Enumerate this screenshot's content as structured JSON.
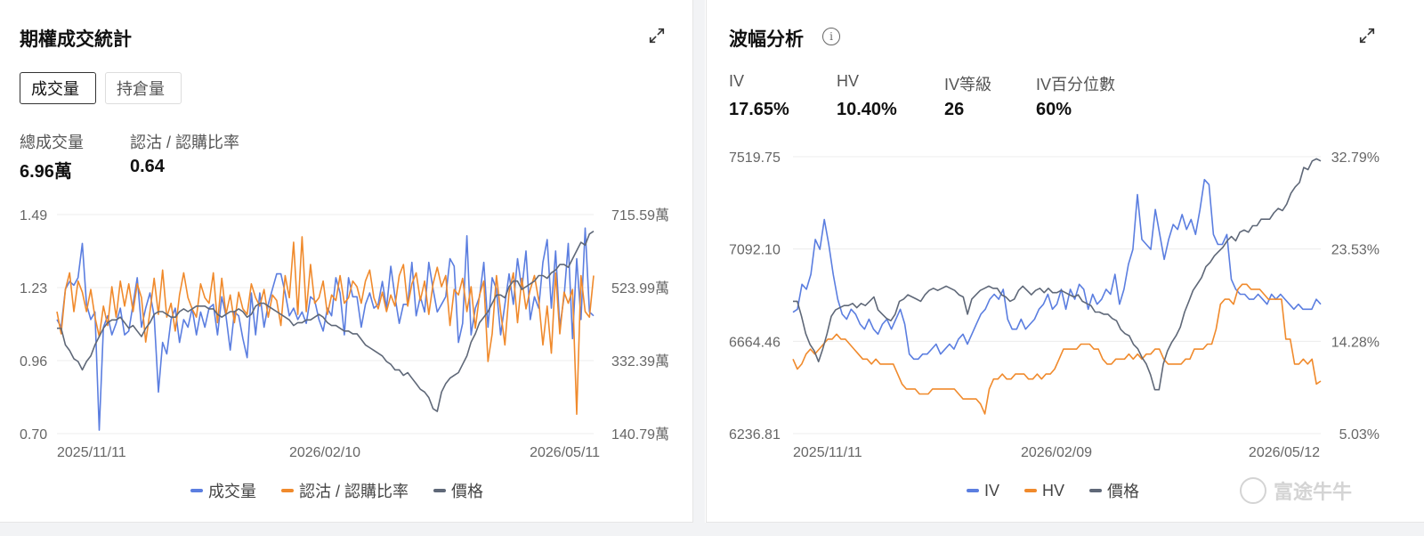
{
  "left": {
    "title": "期權成交統計",
    "tabs": [
      {
        "label": "成交量",
        "active": true
      },
      {
        "label": "持倉量",
        "active": false
      }
    ],
    "stats": [
      {
        "label": "總成交量",
        "value": "6.96萬"
      },
      {
        "label": "認沽 / 認購比率",
        "value": "0.64"
      }
    ]
  },
  "right": {
    "title": "波幅分析",
    "stats": [
      {
        "label": "IV",
        "value": "17.65%"
      },
      {
        "label": "HV",
        "value": "10.40%"
      },
      {
        "label": "IV等級",
        "value": "26"
      },
      {
        "label": "IV百分位數",
        "value": "60%"
      }
    ]
  },
  "watermark": "富途牛牛",
  "colors": {
    "blue": "#5b7ee0",
    "orange": "#f08a2c",
    "gray": "#5f6878"
  },
  "chart_data": [
    {
      "type": "line",
      "y_left_ticks": [
        "1.49",
        "1.23",
        "0.96",
        "0.70"
      ],
      "y_right_ticks": [
        "715.59萬",
        "523.99萬",
        "332.39萬",
        "140.79萬"
      ],
      "x_ticks": [
        "2025/11/11",
        "2026/02/10",
        "2026/05/11"
      ],
      "ylim_left": [
        0.7,
        1.49
      ],
      "ylim_right": [
        140.79,
        715.59
      ],
      "grid": true,
      "legend_position": "bottom",
      "series": [
        {
          "name": "成交量",
          "axis": "right",
          "color": "#5b7ee0",
          "values": [
            440,
            420,
            520,
            540,
            530,
            550,
            640,
            480,
            440,
            460,
            150,
            420,
            450,
            400,
            430,
            470,
            400,
            410,
            480,
            550,
            420,
            470,
            510,
            450,
            250,
            380,
            350,
            440,
            470,
            380,
            440,
            420,
            470,
            400,
            460,
            420,
            470,
            480,
            400,
            500,
            450,
            360,
            460,
            450,
            390,
            340,
            510,
            400,
            510,
            420,
            480,
            520,
            560,
            560,
            510,
            450,
            470,
            440,
            460,
            430,
            500,
            490,
            440,
            410,
            470,
            450,
            550,
            510,
            400,
            550,
            500,
            500,
            420,
            480,
            510,
            470,
            480,
            540,
            470,
            580,
            500,
            430,
            480,
            480,
            590,
            450,
            500,
            460,
            590,
            520,
            460,
            480,
            500,
            600,
            580,
            380,
            430,
            660,
            400,
            470,
            500,
            590,
            420,
            550,
            520,
            400,
            480,
            560,
            480,
            600,
            520,
            620,
            440,
            500,
            470,
            590,
            650,
            470,
            620,
            420,
            500,
            640,
            390,
            600,
            440,
            680,
            460,
            450
          ]
        },
        {
          "name": "認沽 / 認購比率",
          "axis": "left",
          "color": "#f08a2c",
          "values": [
            1.14,
            1.06,
            1.22,
            1.28,
            1.14,
            1.25,
            1.21,
            1.14,
            1.22,
            1.12,
            1.05,
            1.16,
            1.09,
            1.23,
            1.12,
            1.25,
            1.16,
            1.24,
            1.14,
            1.24,
            1.19,
            1.03,
            1.14,
            1.26,
            1.13,
            1.29,
            1.12,
            1.17,
            1.07,
            1.2,
            1.28,
            1.19,
            1.15,
            1.12,
            1.24,
            1.19,
            1.17,
            1.28,
            1.1,
            1.26,
            1.13,
            1.2,
            1.1,
            1.21,
            1.15,
            1.13,
            1.24,
            1.19,
            1.16,
            1.22,
            1.12,
            1.2,
            1.18,
            1.09,
            1.27,
            1.19,
            1.39,
            1.13,
            1.41,
            1.14,
            1.31,
            1.17,
            1.19,
            1.25,
            1.13,
            1.2,
            1.18,
            1.27,
            1.17,
            1.19,
            1.25,
            1.23,
            1.17,
            1.25,
            1.29,
            1.19,
            1.15,
            1.21,
            1.14,
            1.2,
            1.16,
            1.27,
            1.31,
            1.16,
            1.24,
            1.28,
            1.18,
            1.25,
            1.13,
            1.24,
            1.3,
            1.23,
            1.27,
            1.09,
            1.22,
            1.2,
            1.26,
            1.14,
            1.23,
            1.08,
            1.2,
            1.25,
            0.96,
            1.06,
            1.27,
            1.14,
            1.02,
            1.21,
            1.28,
            1.1,
            1.26,
            1.15,
            1.22,
            1.27,
            1.18,
            1.02,
            1.16,
            0.99,
            1.28,
            1.06,
            1.21,
            1.17,
            1.22,
            0.77,
            1.27,
            1.14,
            1.12,
            1.27
          ]
        },
        {
          "name": "價格",
          "axis": "left",
          "color": "#5f6878",
          "values": [
            1.08,
            1.08,
            1.02,
            1.0,
            0.97,
            0.96,
            0.93,
            0.96,
            0.98,
            1.02,
            1.05,
            1.08,
            1.1,
            1.11,
            1.11,
            1.12,
            1.1,
            1.08,
            1.09,
            1.07,
            1.05,
            1.08,
            1.1,
            1.13,
            1.14,
            1.14,
            1.13,
            1.12,
            1.12,
            1.14,
            1.15,
            1.14,
            1.15,
            1.16,
            1.16,
            1.16,
            1.15,
            1.15,
            1.13,
            1.12,
            1.13,
            1.14,
            1.14,
            1.15,
            1.14,
            1.12,
            1.13,
            1.16,
            1.17,
            1.17,
            1.16,
            1.15,
            1.14,
            1.13,
            1.12,
            1.11,
            1.09,
            1.1,
            1.1,
            1.11,
            1.11,
            1.12,
            1.13,
            1.12,
            1.1,
            1.09,
            1.09,
            1.08,
            1.07,
            1.07,
            1.06,
            1.06,
            1.04,
            1.02,
            1.01,
            1.0,
            0.99,
            0.98,
            0.96,
            0.95,
            0.93,
            0.93,
            0.91,
            0.92,
            0.9,
            0.88,
            0.86,
            0.85,
            0.83,
            0.79,
            0.78,
            0.85,
            0.88,
            0.9,
            0.91,
            0.92,
            0.95,
            0.98,
            1.03,
            1.06,
            1.1,
            1.12,
            1.14,
            1.17,
            1.2,
            1.2,
            1.19,
            1.23,
            1.25,
            1.25,
            1.22,
            1.23,
            1.24,
            1.25,
            1.27,
            1.27,
            1.26,
            1.28,
            1.29,
            1.31,
            1.31,
            1.3,
            1.33,
            1.36,
            1.39,
            1.38,
            1.42,
            1.43
          ]
        }
      ]
    },
    {
      "type": "line",
      "y_left_ticks": [
        "7519.75",
        "7092.10",
        "6664.46",
        "6236.81"
      ],
      "y_right_ticks": [
        "32.79%",
        "23.53%",
        "14.28%",
        "5.03%"
      ],
      "x_ticks": [
        "2025/11/11",
        "2026/02/09",
        "2026/05/12"
      ],
      "ylim_left": [
        6236.81,
        7519.75
      ],
      "ylim_right": [
        5.03,
        32.79
      ],
      "grid": true,
      "legend_position": "bottom",
      "series": [
        {
          "name": "IV",
          "axis": "right",
          "color": "#5b7ee0",
          "values": [
            17.2,
            17.5,
            20.0,
            19.5,
            21.0,
            24.5,
            23.5,
            26.5,
            24.0,
            21.0,
            18.5,
            17.0,
            16.5,
            17.5,
            17.0,
            16.0,
            15.5,
            16.5,
            15.5,
            15.0,
            16.0,
            16.5,
            15.5,
            16.5,
            17.5,
            16.0,
            13.0,
            12.5,
            12.5,
            13.0,
            13.0,
            13.5,
            14.0,
            13.0,
            13.5,
            14.0,
            13.5,
            14.5,
            15.0,
            14.0,
            15.0,
            16.0,
            17.0,
            17.5,
            18.5,
            19.0,
            18.5,
            19.5,
            16.5,
            15.5,
            15.5,
            16.5,
            15.5,
            16.0,
            16.5,
            17.5,
            18.0,
            19.0,
            17.5,
            18.0,
            19.5,
            17.5,
            19.5,
            18.5,
            20.0,
            19.5,
            17.5,
            19.0,
            18.0,
            18.5,
            19.5,
            19.0,
            21.0,
            18.0,
            19.5,
            22.0,
            23.5,
            29.0,
            24.5,
            24.0,
            23.5,
            27.5,
            25.0,
            22.5,
            24.5,
            26.0,
            25.5,
            27.0,
            25.5,
            26.5,
            25.0,
            27.5,
            30.5,
            30.0,
            25.0,
            24.0,
            24.0,
            25.0,
            20.5,
            19.5,
            19.0,
            19.0,
            18.5,
            18.5,
            19.0,
            18.5,
            18.0,
            19.0,
            18.5,
            19.0,
            18.5,
            18.0,
            17.5,
            18.0,
            17.5,
            17.5,
            17.5,
            18.5,
            18.0
          ]
        },
        {
          "name": "HV",
          "axis": "right",
          "color": "#f08a2c",
          "values": [
            12.5,
            11.5,
            12.0,
            13.0,
            13.5,
            13.0,
            13.5,
            14.0,
            14.5,
            14.5,
            15.0,
            14.5,
            14.5,
            14.0,
            13.5,
            13.0,
            12.5,
            12.5,
            12.0,
            12.5,
            12.0,
            12.0,
            12.0,
            12.0,
            11.0,
            10.0,
            9.5,
            9.5,
            9.5,
            9.0,
            9.0,
            9.0,
            9.5,
            9.5,
            9.5,
            9.5,
            9.5,
            9.5,
            9.0,
            8.5,
            8.5,
            8.5,
            8.5,
            8.0,
            7.0,
            9.5,
            10.5,
            10.5,
            11.0,
            10.5,
            10.5,
            11.0,
            11.0,
            11.0,
            10.5,
            10.5,
            11.0,
            10.5,
            11.0,
            11.0,
            11.5,
            12.5,
            13.5,
            13.5,
            13.5,
            13.5,
            14.0,
            14.0,
            14.0,
            13.5,
            13.5,
            12.5,
            12.0,
            12.0,
            12.5,
            12.5,
            12.5,
            13.0,
            12.5,
            13.0,
            12.5,
            13.0,
            13.0,
            13.5,
            13.5,
            12.5,
            12.0,
            12.0,
            12.0,
            12.0,
            12.5,
            12.5,
            13.5,
            13.5,
            13.5,
            14.0,
            14.0,
            15.5,
            18.0,
            18.5,
            18.5,
            18.0,
            19.5,
            20.0,
            20.0,
            19.5,
            19.5,
            19.5,
            19.0,
            18.5,
            18.5,
            18.5,
            18.5,
            14.5,
            14.5,
            12.0,
            12.0,
            12.5,
            12.0,
            12.5,
            10.0,
            10.3
          ]
        },
        {
          "name": "價格",
          "axis": "left",
          "color": "#5f6878",
          "values": [
            6850,
            6850,
            6780,
            6700,
            6650,
            6620,
            6570,
            6630,
            6700,
            6780,
            6810,
            6820,
            6830,
            6830,
            6840,
            6820,
            6840,
            6830,
            6850,
            6870,
            6810,
            6790,
            6770,
            6760,
            6790,
            6850,
            6860,
            6880,
            6870,
            6860,
            6850,
            6880,
            6900,
            6910,
            6900,
            6910,
            6920,
            6910,
            6900,
            6880,
            6870,
            6790,
            6860,
            6880,
            6900,
            6910,
            6920,
            6910,
            6910,
            6880,
            6870,
            6850,
            6860,
            6900,
            6920,
            6900,
            6880,
            6900,
            6910,
            6890,
            6910,
            6890,
            6890,
            6900,
            6890,
            6880,
            6870,
            6880,
            6850,
            6840,
            6830,
            6800,
            6800,
            6790,
            6790,
            6770,
            6760,
            6720,
            6700,
            6690,
            6650,
            6630,
            6590,
            6560,
            6510,
            6440,
            6440,
            6560,
            6620,
            6660,
            6690,
            6730,
            6800,
            6850,
            6900,
            6930,
            6960,
            7010,
            7030,
            7060,
            7080,
            7100,
            7130,
            7150,
            7130,
            7170,
            7180,
            7170,
            7200,
            7200,
            7230,
            7230,
            7230,
            7260,
            7280,
            7270,
            7300,
            7350,
            7380,
            7400,
            7470,
            7460,
            7500,
            7510,
            7500
          ]
        }
      ]
    }
  ]
}
